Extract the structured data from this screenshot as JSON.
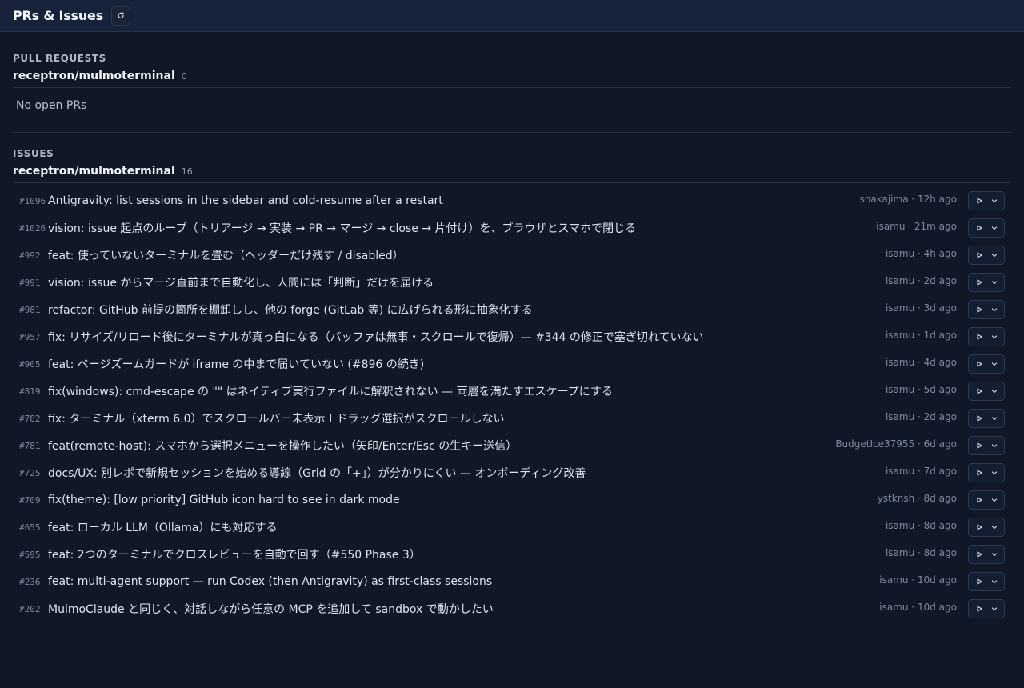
{
  "header": {
    "title": "PRs & Issues"
  },
  "pull_requests": {
    "label": "PULL REQUESTS",
    "repo": "receptron/mulmoterminal",
    "count": "0",
    "empty_text": "No open PRs"
  },
  "issues": {
    "label": "ISSUES",
    "repo": "receptron/mulmoterminal",
    "count": "16",
    "items": [
      {
        "number": "#1096",
        "title": "Antigravity: list sessions in the sidebar and cold-resume after a restart",
        "meta": "snakajima · 12h ago"
      },
      {
        "number": "#1026",
        "title": "vision: issue 起点のループ（トリアージ → 実装 → PR → マージ → close → 片付け）を、ブラウザとスマホで閉じる",
        "meta": "isamu · 21m ago"
      },
      {
        "number": "#992",
        "title": "feat: 使っていないターミナルを畳む（ヘッダーだけ残す / disabled）",
        "meta": "isamu · 4h ago"
      },
      {
        "number": "#991",
        "title": "vision: issue からマージ直前まで自動化し、人間には「判断」だけを届ける",
        "meta": "isamu · 2d ago"
      },
      {
        "number": "#981",
        "title": "refactor: GitHub 前提の箇所を棚卸しし、他の forge (GitLab 等) に広げられる形に抽象化する",
        "meta": "isamu · 3d ago"
      },
      {
        "number": "#957",
        "title": "fix: リサイズ/リロード後にターミナルが真っ白になる（バッファは無事・スクロールで復帰）— #344 の修正で塞ぎ切れていない",
        "meta": "isamu · 1d ago"
      },
      {
        "number": "#905",
        "title": "feat: ページズームガードが iframe の中まで届いていない (#896 の続き)",
        "meta": "isamu · 4d ago"
      },
      {
        "number": "#819",
        "title": "fix(windows): cmd-escape の \"\" はネイティブ実行ファイルに解釈されない — 両層を満たすエスケープにする",
        "meta": "isamu · 5d ago"
      },
      {
        "number": "#782",
        "title": "fix: ターミナル（xterm 6.0）でスクロールバー未表示＋ドラッグ選択がスクロールしない",
        "meta": "isamu · 2d ago"
      },
      {
        "number": "#781",
        "title": "feat(remote-host): スマホから選択メニューを操作したい（矢印/Enter/Esc の生キー送信）",
        "meta": "BudgetIce37955 · 6d ago"
      },
      {
        "number": "#725",
        "title": "docs/UX: 別レポで新規セッションを始める導線（Grid の「+」）が分かりにくい — オンボーディング改善",
        "meta": "isamu · 7d ago"
      },
      {
        "number": "#709",
        "title": "fix(theme): [low priority] GitHub icon hard to see in dark mode",
        "meta": "ystknsh · 8d ago"
      },
      {
        "number": "#655",
        "title": "feat: ローカル LLM（Ollama）にも対応する",
        "meta": "isamu · 8d ago"
      },
      {
        "number": "#595",
        "title": "feat: 2つのターミナルでクロスレビューを自動で回す（#550 Phase 3）",
        "meta": "isamu · 8d ago"
      },
      {
        "number": "#236",
        "title": "feat: multi-agent support — run Codex (then Antigravity) as first-class sessions",
        "meta": "isamu · 10d ago"
      },
      {
        "number": "#202",
        "title": "MulmoClaude と同じく、対話しながら任意の MCP を追加して sandbox で動かしたい",
        "meta": "isamu · 10d ago"
      }
    ]
  }
}
